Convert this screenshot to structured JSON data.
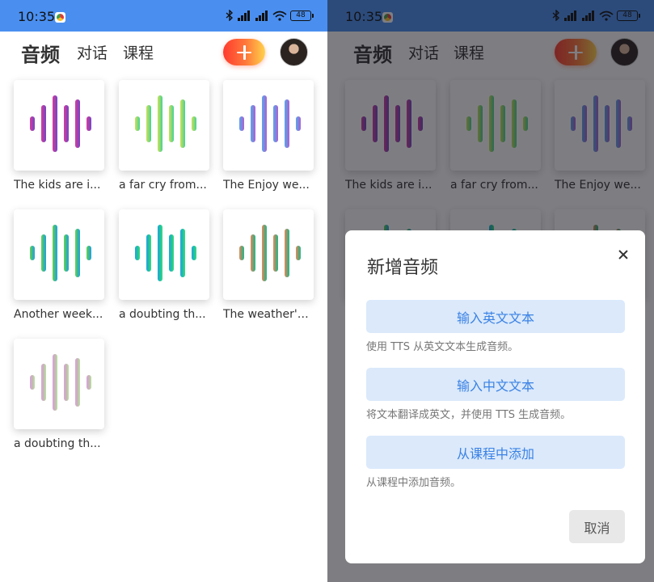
{
  "status_bar": {
    "time": "10:35",
    "battery": "48"
  },
  "header": {
    "tabs": [
      "音频",
      "对话",
      "课程"
    ]
  },
  "audio_items": [
    {
      "title": "The kids are i...",
      "colors": [
        "#d63e9e",
        "#a43fb0",
        "#6e4bc2"
      ]
    },
    {
      "title": "a far cry from...",
      "colors": [
        "#c9e25a",
        "#8ed872",
        "#3fd39a"
      ]
    },
    {
      "title": "The Enjoy we...",
      "colors": [
        "#5fa6e8",
        "#7b86de",
        "#b05fd2"
      ]
    },
    {
      "title": "Another week...",
      "colors": [
        "#6fd34a",
        "#36b898",
        "#2a9ee0"
      ]
    },
    {
      "title": "a doubting th...",
      "colors": [
        "#2a9fe5",
        "#18c3a2",
        "#42d77a"
      ]
    },
    {
      "title": "The weather's...",
      "colors": [
        "#e98b5e",
        "#7d9b70",
        "#21ba88"
      ]
    },
    {
      "title": "a doubting th...",
      "colors": [
        "#d9a3e0",
        "#c7b4b3",
        "#b5e3a0"
      ]
    }
  ],
  "dialog": {
    "title": "新增音频",
    "options": [
      {
        "label": "输入英文文本",
        "description": "使用 TTS 从英文文本生成音频。"
      },
      {
        "label": "输入中文文本",
        "description": "将文本翻译成英文，并使用 TTS 生成音频。"
      },
      {
        "label": "从课程中添加",
        "description": "从课程中添加音频。"
      }
    ],
    "cancel_label": "取消"
  },
  "colors": {
    "status_bar": "#4a8ff0",
    "accent": "#3a82e4",
    "option_bg": "#dbe9fb",
    "add_gradient": [
      "#ff3b30",
      "#ffd24a"
    ]
  }
}
